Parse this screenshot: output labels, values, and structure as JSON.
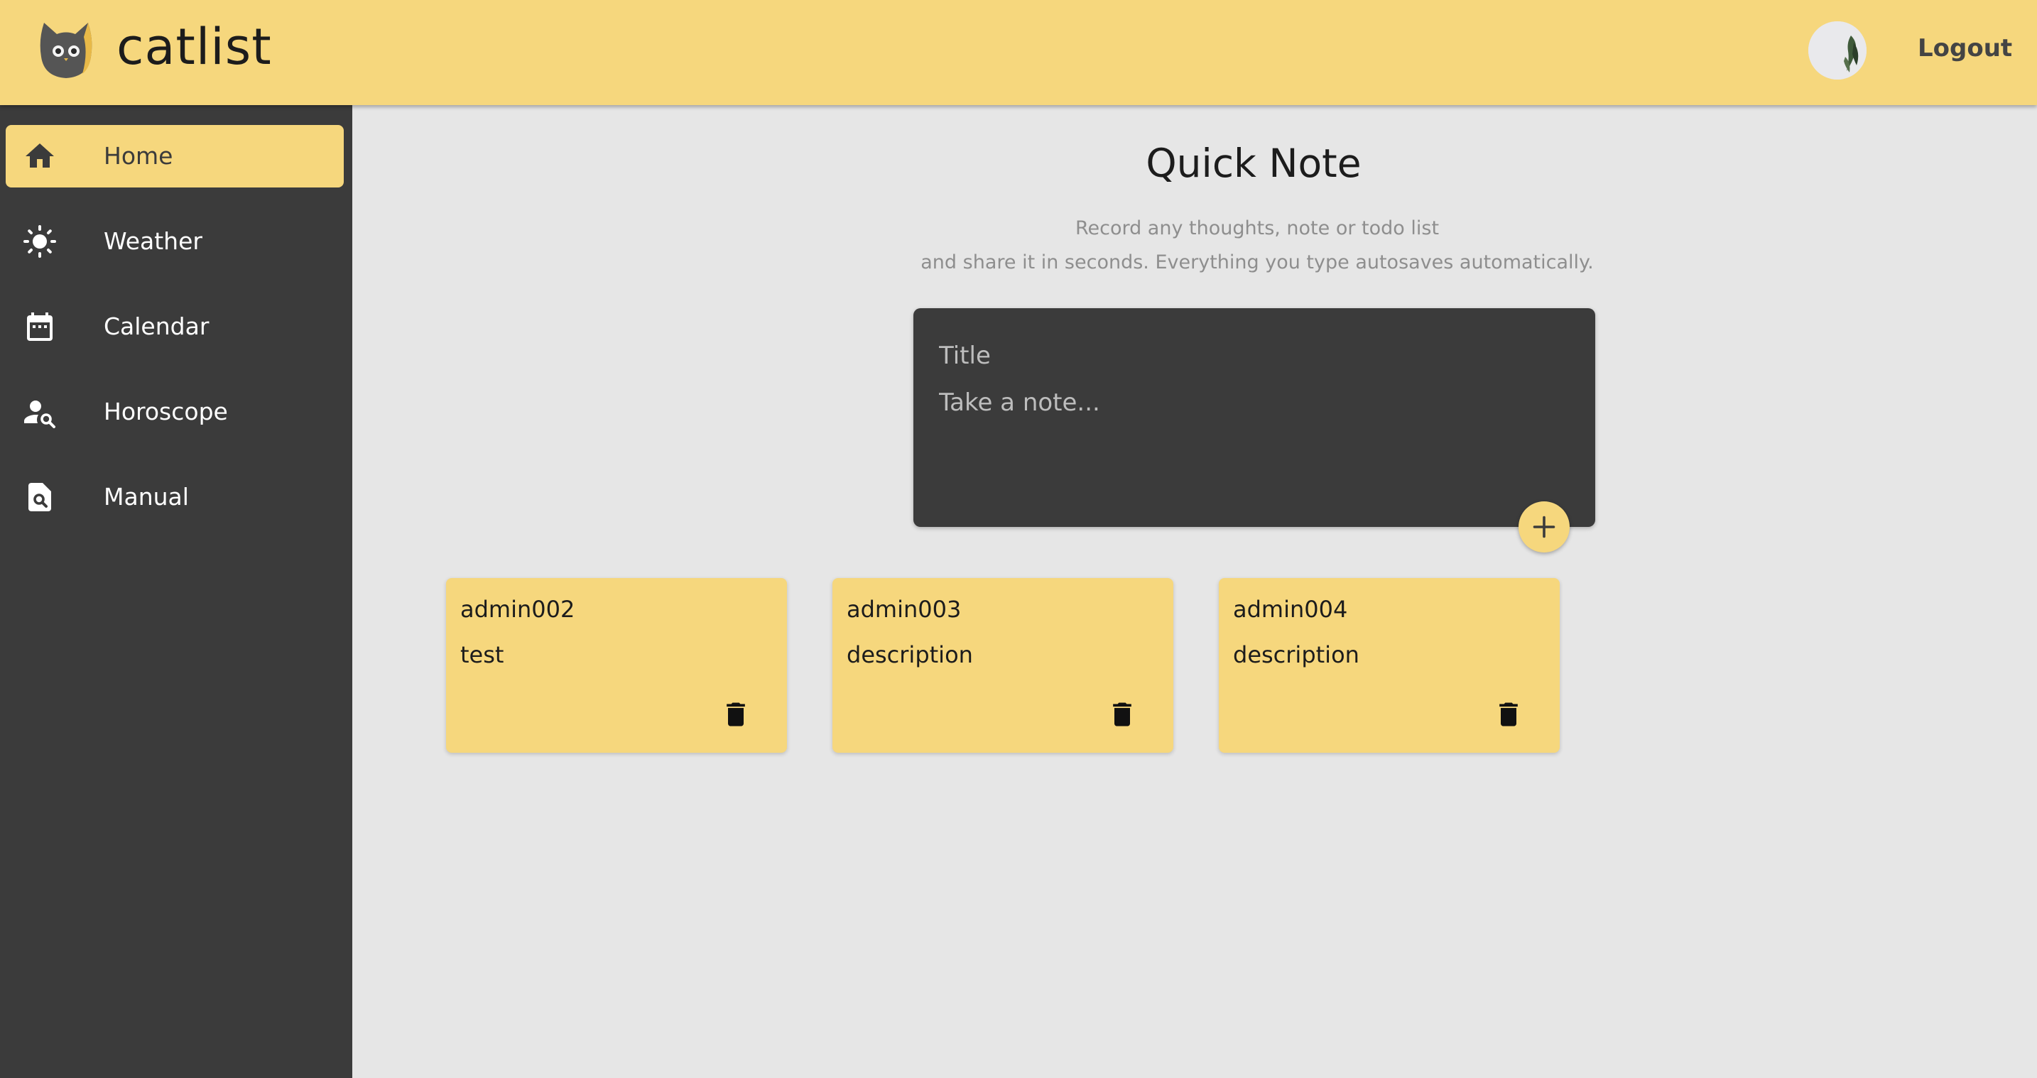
{
  "header": {
    "brand": "catlist",
    "logo_icon": "cat-logo-icon",
    "logout_label": "Logout",
    "avatar_icon": "user-avatar"
  },
  "sidebar": {
    "items": [
      {
        "label": "Home",
        "icon": "home-icon",
        "active": true
      },
      {
        "label": "Weather",
        "icon": "sun-icon",
        "active": false
      },
      {
        "label": "Calendar",
        "icon": "calendar-icon",
        "active": false
      },
      {
        "label": "Horoscope",
        "icon": "person-search-icon",
        "active": false
      },
      {
        "label": "Manual",
        "icon": "document-search-icon",
        "active": false
      }
    ]
  },
  "main": {
    "title": "Quick Note",
    "subtitle_line1": "Record any thoughts, note or todo list",
    "subtitle_line2": "and share it in seconds. Everything you type autosaves automatically.",
    "form": {
      "title_placeholder": "Title",
      "body_placeholder": "Take a note...",
      "add_icon": "plus-icon"
    },
    "notes": [
      {
        "title": "admin002",
        "body": "test"
      },
      {
        "title": "admin003",
        "body": "description"
      },
      {
        "title": "admin004",
        "body": "description"
      }
    ]
  },
  "colors": {
    "accent": "#f6d77d",
    "sidebar": "#3b3b3b",
    "background": "#e6e6e6"
  }
}
